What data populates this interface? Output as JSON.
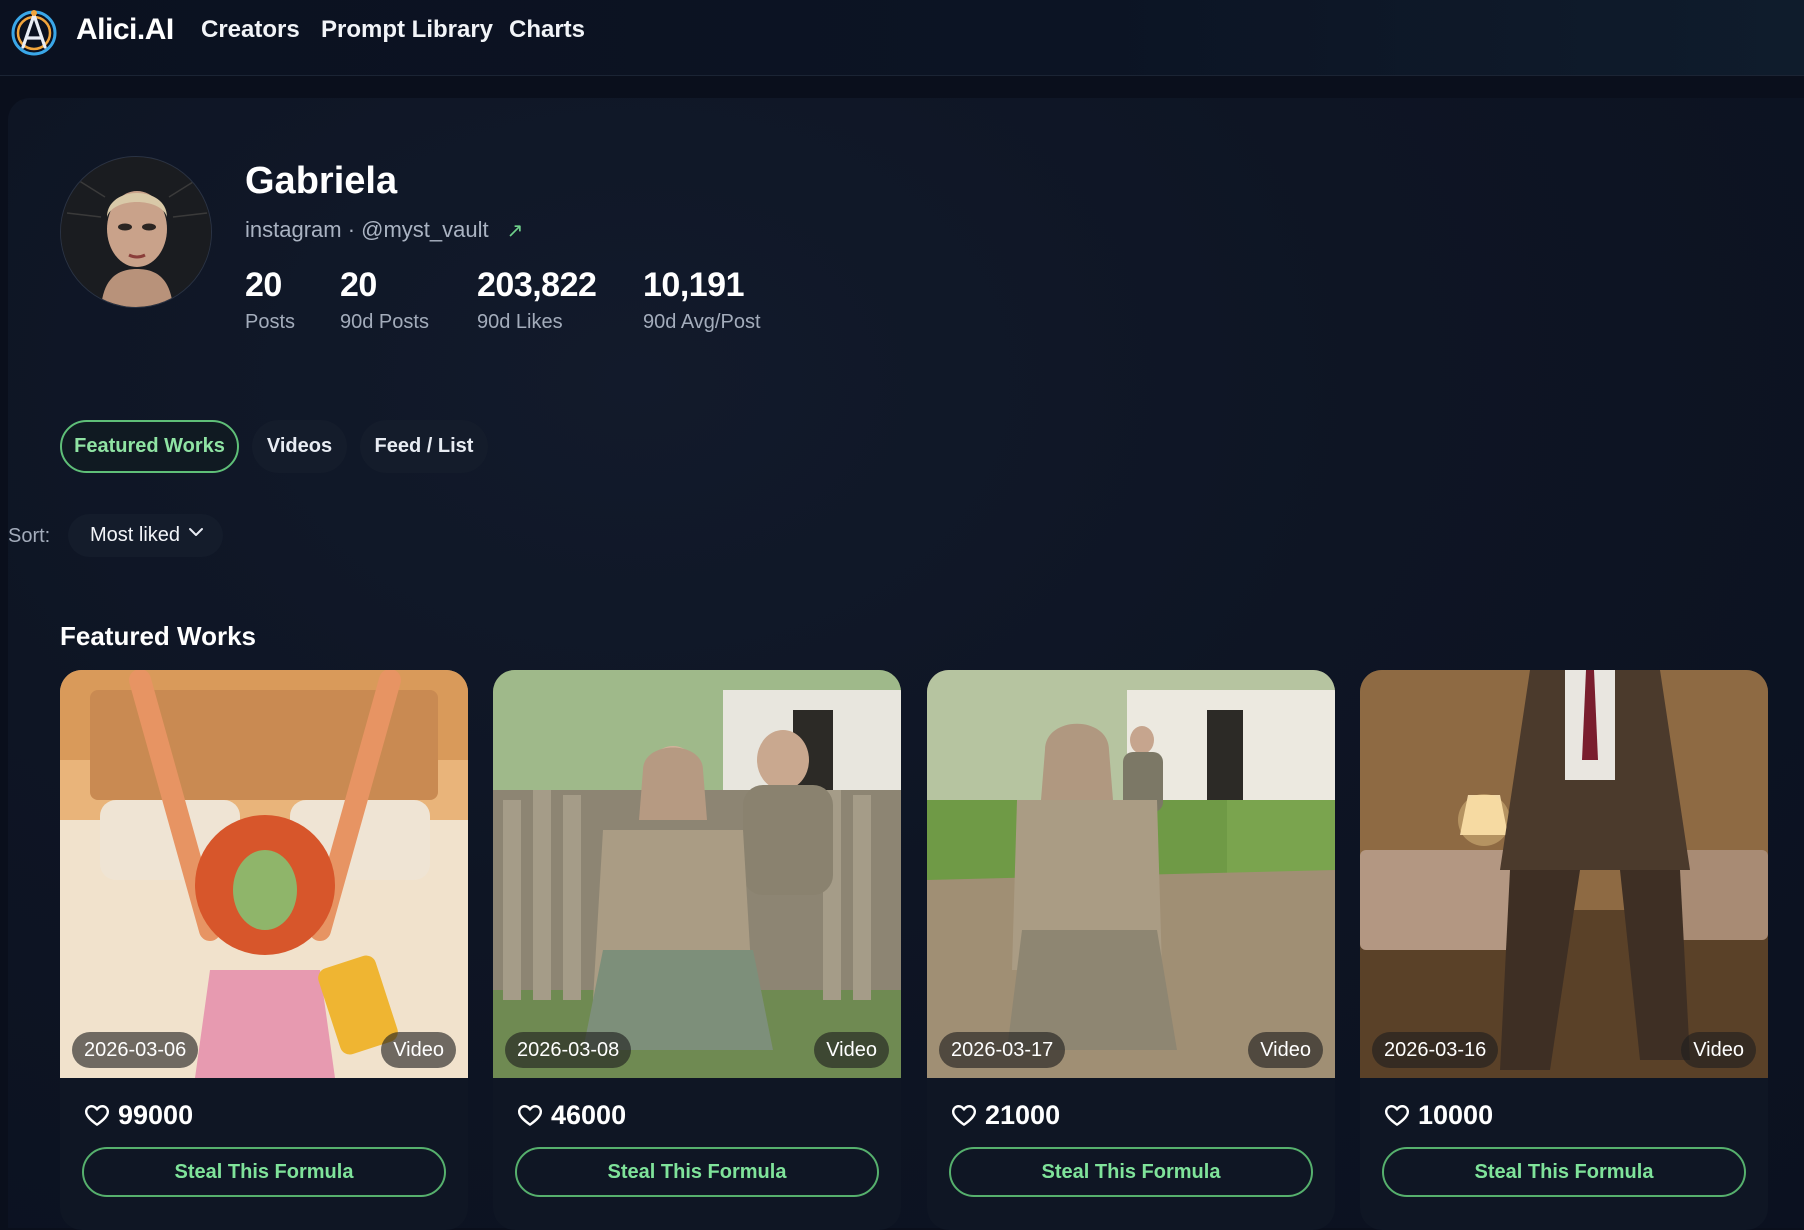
{
  "app": {
    "brand": "Alici.AI"
  },
  "nav": {
    "items": [
      "Creators",
      "Prompt Library",
      "Charts"
    ]
  },
  "profile": {
    "name": "Gabriela",
    "handle": "instagram · @myst_vault",
    "stats": [
      {
        "value": "20",
        "label": "Posts"
      },
      {
        "value": "20",
        "label": "90d Posts"
      },
      {
        "value": "203,822",
        "label": "90d Likes"
      },
      {
        "value": "10,191",
        "label": "90d Avg/Post"
      }
    ]
  },
  "tabs": {
    "items": [
      "Featured Works",
      "Videos",
      "Feed / List"
    ],
    "active": "Featured Works"
  },
  "sort": {
    "label": "Sort:",
    "value": "Most liked"
  },
  "section": {
    "title": "Featured Works"
  },
  "cards": [
    {
      "date": "2026-03-06",
      "type": "Video",
      "likes": "99000",
      "button": "Steal This Formula",
      "thumb_icon": "bedroom-carrot-doll-thumbnail"
    },
    {
      "date": "2026-03-08",
      "type": "Video",
      "likes": "46000",
      "button": "Steal This Formula",
      "thumb_icon": "village-fence-dance-thumbnail"
    },
    {
      "date": "2026-03-17",
      "type": "Video",
      "likes": "21000",
      "button": "Steal This Formula",
      "thumb_icon": "village-yard-dance-thumbnail"
    },
    {
      "date": "2026-03-16",
      "type": "Video",
      "likes": "10000",
      "button": "Steal This Formula",
      "thumb_icon": "bedroom-suit-dance-thumbnail"
    }
  ],
  "colors": {
    "accent_green": "#5fbf78",
    "background": "#0a0f1c",
    "panel": "#0e1524"
  }
}
